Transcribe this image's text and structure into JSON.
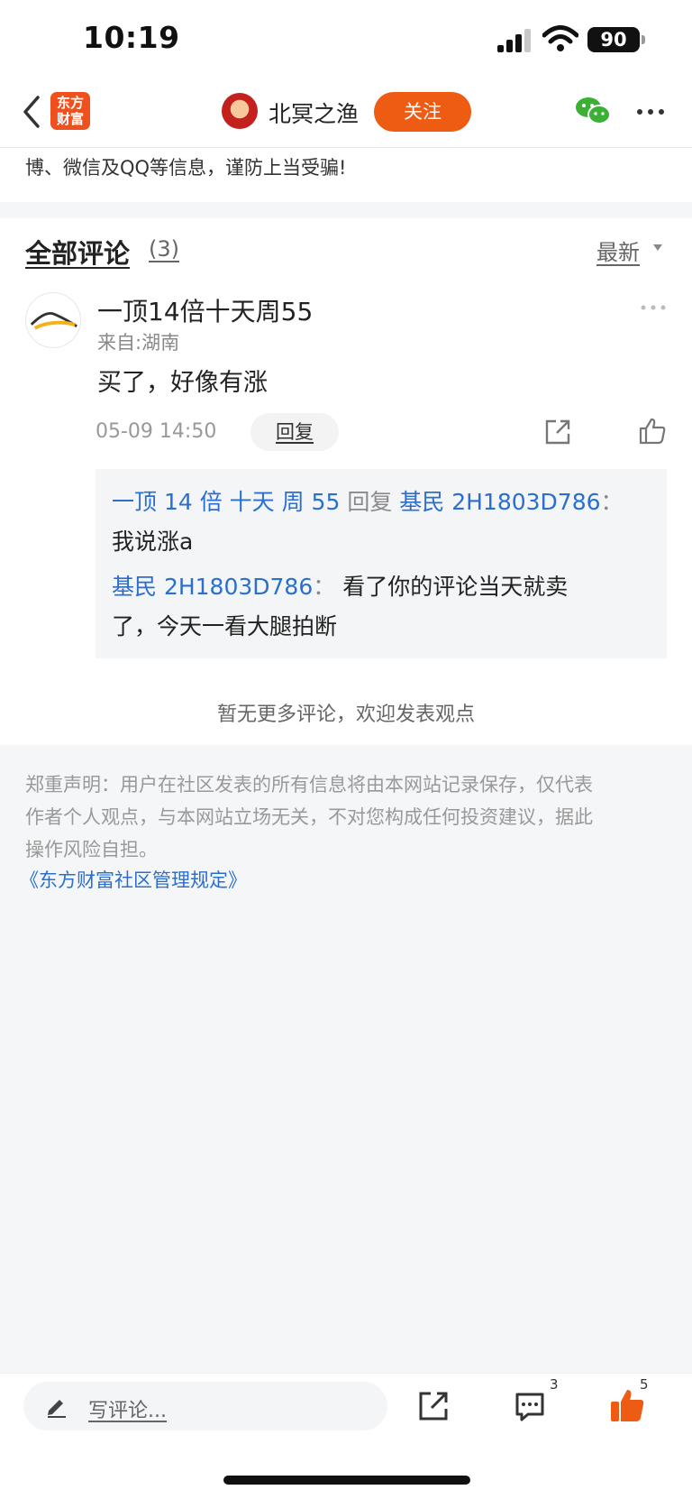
{
  "status_bar": {
    "time": "10:19",
    "battery": "90"
  },
  "nav": {
    "logo_line1": "东方",
    "logo_line2": "财富",
    "author_name": "北冥之渔",
    "follow_label": "关注"
  },
  "notice": "博、微信及QQ等信息，谨防上当受骗!",
  "comments": {
    "title": "全部评论",
    "count": "(3)",
    "sort_label": "最新",
    "item": {
      "user": "一顶14倍十天周55",
      "location": "来自:湖南",
      "text": "买了，好像有涨",
      "time": "05-09 14:50",
      "reply_label": "回复"
    },
    "replies": [
      {
        "from": "一顶 14 倍 十天 周 55",
        "verb": "回复",
        "to": "基民 2H1803D786",
        "sep": "：",
        "text": "我说涨a"
      },
      {
        "from": "基民 2H1803D786",
        "sep": "：",
        "text_line1": "看了你的评论当天就卖",
        "text_line2": "了，今天一看大腿拍断"
      }
    ],
    "end_text": "暂无更多评论，欢迎发表观点"
  },
  "disclaimer": {
    "line1": "郑重声明：用户在社区发表的所有信息将由本网站记录保存，仅代表",
    "line2": "作者个人观点，与本网站立场无关，不对您构成任何投资建议，据此",
    "line3": "操作风险自担。",
    "link": "《东方财富社区管理规定》"
  },
  "bottom_bar": {
    "placeholder": "写评论...",
    "comment_count": "3",
    "like_count": "5"
  },
  "colors": {
    "accent": "#ee5b13",
    "link": "#2a6fd0"
  },
  "icons": [
    "back-arrow-icon",
    "wechat-icon",
    "more-icon",
    "share-icon",
    "like-icon",
    "pencil-icon",
    "comment-icon",
    "thumb-up-icon"
  ]
}
